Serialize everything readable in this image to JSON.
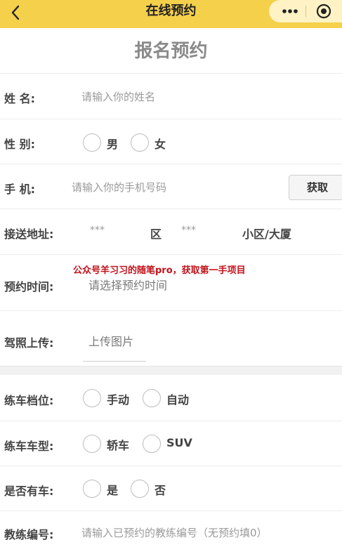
{
  "header": {
    "title": "在线预约",
    "back_icon": "chevron-left-icon",
    "more_icon": "more-dots-icon",
    "capsule_icon": "target-icon"
  },
  "form": {
    "title": "报名预约",
    "name": {
      "label": "姓 名:",
      "placeholder": "请输入你的姓名"
    },
    "gender": {
      "label": "性 别:",
      "options": [
        "男",
        "女"
      ]
    },
    "phone": {
      "label": "手 机:",
      "placeholder": "请输入你的手机号码",
      "button": "获取"
    },
    "address": {
      "label": "接送地址:",
      "district_value": "***",
      "district_unit": "区",
      "community_value": "***",
      "community_unit": "小区/大厦"
    },
    "watermark": "公众号羊习习的随笔pro，获取第一手项目",
    "time": {
      "label": "预约时间:",
      "placeholder": "请选择预约时间"
    },
    "license": {
      "label": "驾照上传:",
      "upload_text": "上传图片"
    },
    "gear": {
      "label": "练车档位:",
      "options": [
        "手动",
        "自动"
      ]
    },
    "car_type": {
      "label": "练车车型:",
      "options": [
        "轿车",
        "SUV"
      ]
    },
    "has_car": {
      "label": "是否有车:",
      "options": [
        "是",
        "否"
      ]
    },
    "coach": {
      "label": "教练编号:",
      "placeholder": "请输入已预约的教练编号（无预约填0）"
    }
  },
  "colors": {
    "header_bg": "#f5d04b",
    "watermark": "#c1121a"
  }
}
